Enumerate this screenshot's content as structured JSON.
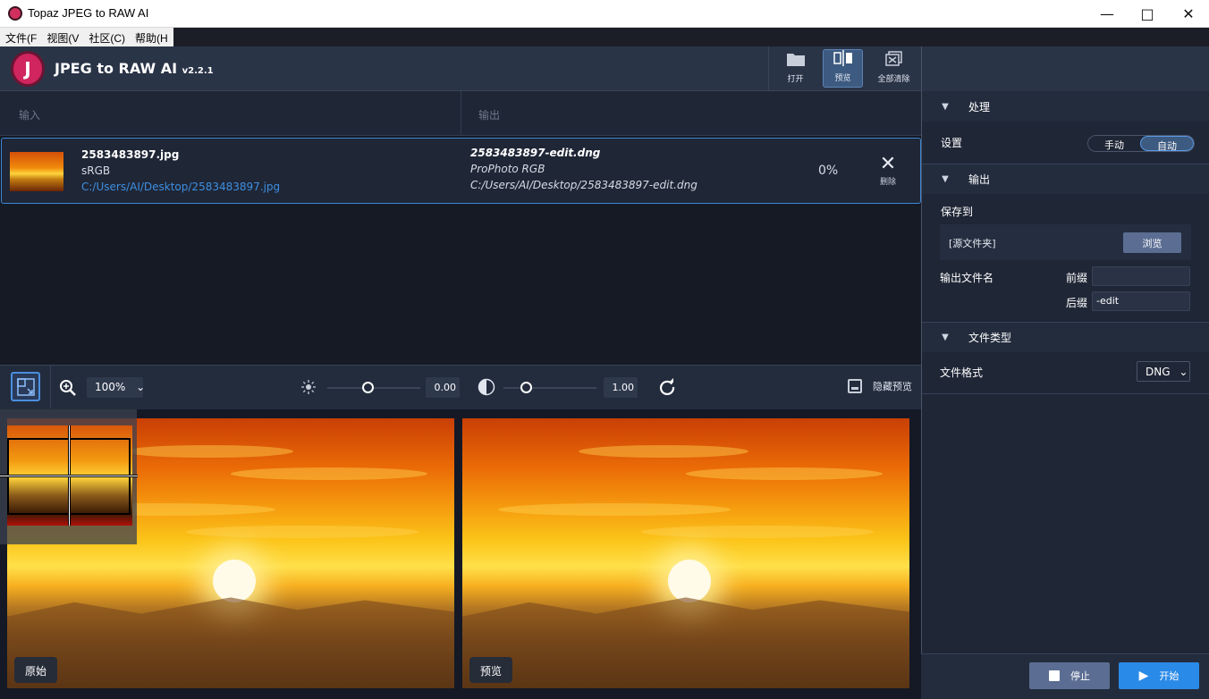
{
  "window": {
    "title": "Topaz JPEG to RAW AI"
  },
  "menu": [
    "文件(F",
    "视图(V",
    "社区(C)",
    "帮助(H"
  ],
  "app": {
    "name": "JPEG to RAW AI",
    "version": "v2.2.1",
    "logo_letter": "J"
  },
  "toolbar": {
    "open_label": "打开",
    "preview_label": "预览",
    "clear_all_label": "全部清除"
  },
  "columns": {
    "input": "输入",
    "output": "输出"
  },
  "file": {
    "input_name": "2583483897.jpg",
    "input_colorspace": "sRGB",
    "input_path": "C:/Users/AI/Desktop/2583483897.jpg",
    "output_name": "2583483897-edit.dng",
    "output_colorspace": "ProPhoto RGB",
    "output_path": "C:/Users/AI/Desktop/2583483897-edit.dng",
    "progress": "0%",
    "delete_label": "删除"
  },
  "preview_controls": {
    "zoom": "100%",
    "exposure_value": "0.00",
    "contrast_value": "1.00",
    "hide_preview_label": "隐藏预览"
  },
  "panes": {
    "original_label": "原始",
    "preview_label": "预览"
  },
  "sidebar": {
    "processing": {
      "title": "处理",
      "settings_label": "设置",
      "manual": "手动",
      "auto": "自动",
      "selected": "auto"
    },
    "output": {
      "title": "输出",
      "save_to_label": "保存到",
      "save_to_value": "[源文件夹]",
      "browse_label": "浏览",
      "filename_label": "输出文件名",
      "prefix_label": "前缀",
      "prefix_value": "",
      "suffix_label": "后缀",
      "suffix_value": "-edit"
    },
    "file_type": {
      "title": "文件类型",
      "format_label": "文件格式",
      "format_value": "DNG"
    }
  },
  "actions": {
    "stop_label": "停止",
    "start_label": "开始"
  },
  "colors": {
    "accent": "#2a8ae8",
    "selection_border": "#3c86d6",
    "logo": "#d0255e",
    "link": "#3d8fe0"
  }
}
